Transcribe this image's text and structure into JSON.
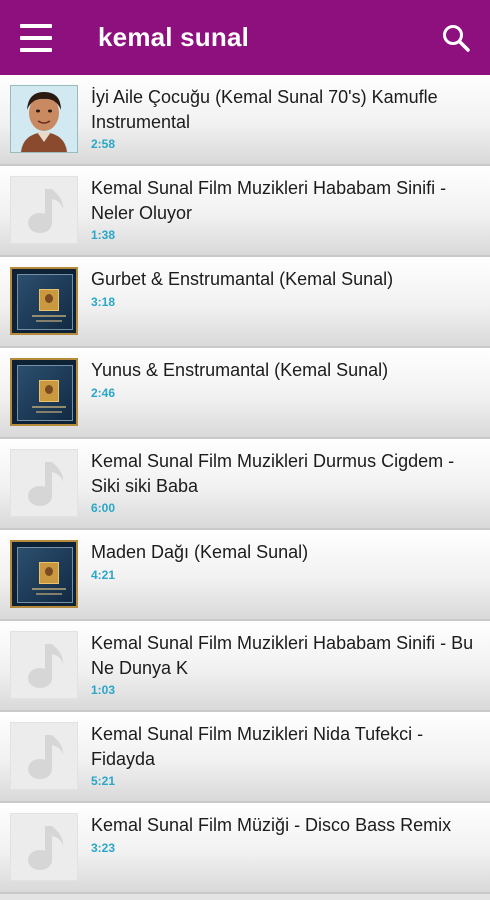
{
  "appbar": {
    "title": "kemal sunal",
    "menu_icon": "hamburger-menu-icon",
    "search_icon": "search-icon",
    "color": "#8e0f7e"
  },
  "accent_color": "#29a6c8",
  "songs": [
    {
      "title": "İyi Aile Çocuğu (Kemal Sunal 70's) Kamufle Instrumental",
      "duration": "2:58",
      "thumb": "portrait"
    },
    {
      "title": "Kemal Sunal Film Muzikleri Hababam Sinifi - Neler Oluyor",
      "duration": "1:38",
      "thumb": "note"
    },
    {
      "title": "Gurbet & Enstrumantal (Kemal Sunal)",
      "duration": "3:18",
      "thumb": "album"
    },
    {
      "title": "Yunus & Enstrumantal (Kemal Sunal)",
      "duration": "2:46",
      "thumb": "album"
    },
    {
      "title": "Kemal Sunal Film Muzikleri Durmus Cigdem - Siki siki Baba",
      "duration": "6:00",
      "thumb": "note"
    },
    {
      "title": "Maden Dağı (Kemal Sunal)",
      "duration": "4:21",
      "thumb": "album"
    },
    {
      "title": "Kemal Sunal Film Muzikleri Hababam Sinifi - Bu Ne Dunya K",
      "duration": "1:03",
      "thumb": "note"
    },
    {
      "title": "Kemal Sunal Film Muzikleri Nida Tufekci - Fidayda",
      "duration": "5:21",
      "thumb": "note"
    },
    {
      "title": "Kemal Sunal Film Müziği - Disco Bass Remix",
      "duration": "3:23",
      "thumb": "note"
    }
  ]
}
